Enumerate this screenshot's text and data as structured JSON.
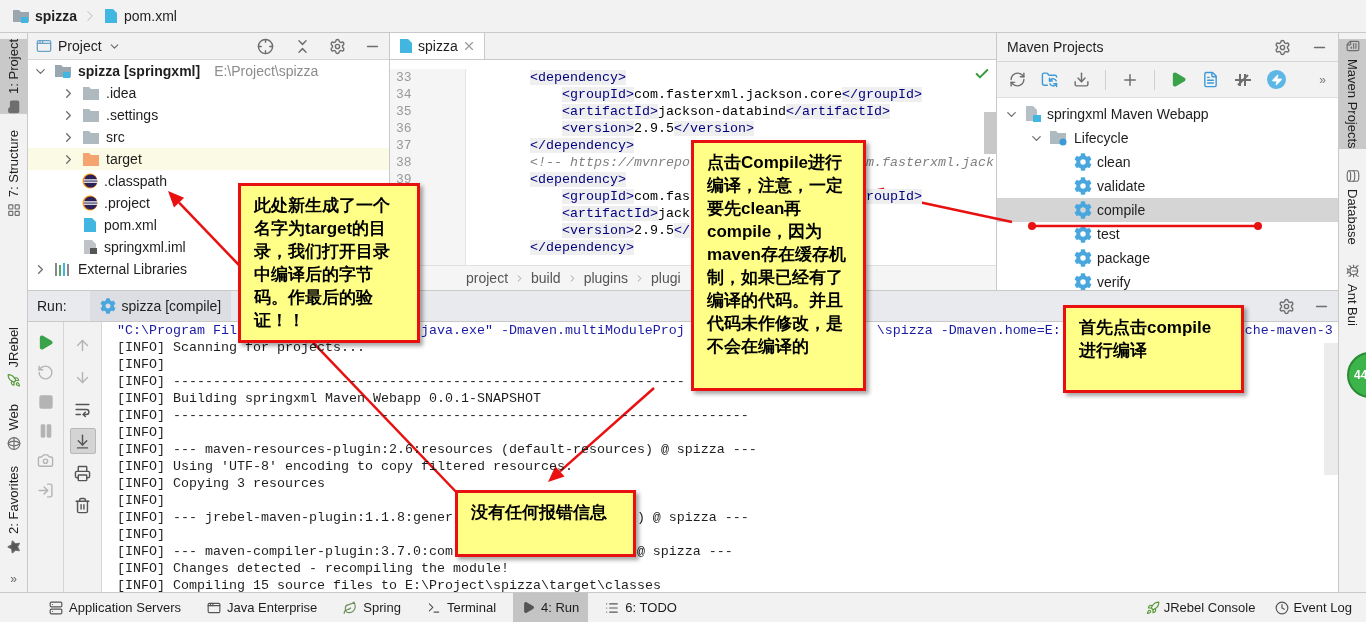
{
  "breadcrumb": [
    {
      "label": "spizza",
      "kind": "module"
    },
    {
      "label": "pom.xml",
      "kind": "maven"
    }
  ],
  "left_stripe": {
    "top": [
      {
        "label": "1: Project",
        "kind": "folder",
        "selected": true
      },
      {
        "label": "7: Structure",
        "kind": "structure",
        "selected": false
      }
    ],
    "bottom": [
      {
        "label": "JRebel",
        "kind": "jrebel"
      },
      {
        "label": "Web",
        "kind": "globe"
      },
      {
        "label": "2: Favorites",
        "kind": "star"
      }
    ],
    "more": "»"
  },
  "project_panel": {
    "title": "Project",
    "tree": [
      {
        "label": "spizza [springxml]",
        "path": "E:\\Project\\spizza",
        "kind": "module",
        "expanded": true,
        "children": [
          {
            "label": ".idea",
            "kind": "folder",
            "expanded": false,
            "highlighted": false
          },
          {
            "label": ".settings",
            "kind": "folder",
            "expanded": false,
            "highlighted": false
          },
          {
            "label": "src",
            "kind": "folder",
            "expanded": false,
            "highlighted": false
          },
          {
            "label": "target",
            "kind": "excluded",
            "expanded": false,
            "highlighted": true
          },
          {
            "label": ".classpath",
            "kind": "eclipse",
            "highlighted": false
          },
          {
            "label": ".project",
            "kind": "eclipse",
            "highlighted": false
          },
          {
            "label": "pom.xml",
            "kind": "maven",
            "highlighted": false
          },
          {
            "label": "springxml.iml",
            "kind": "iml",
            "highlighted": false
          }
        ]
      },
      {
        "label": "External Libraries",
        "kind": "library",
        "expanded": false
      }
    ]
  },
  "editor": {
    "tab": {
      "label": "spizza",
      "selected": true
    },
    "lines": [
      {
        "number": "33",
        "tokens": [
          {
            "kind": "tag",
            "text": "        <dependency>"
          }
        ]
      },
      {
        "number": "34",
        "tokens": [
          {
            "kind": "tag",
            "text": "            <groupId>"
          },
          {
            "kind": "text",
            "text": "com.fasterxml.jackson.core"
          },
          {
            "kind": "tag",
            "text": "</groupId>"
          }
        ]
      },
      {
        "number": "35",
        "tokens": [
          {
            "kind": "tag",
            "text": "            <artifactId>"
          },
          {
            "kind": "text",
            "text": "jackson-databind"
          },
          {
            "kind": "tag",
            "text": "</artifactId>"
          }
        ]
      },
      {
        "number": "36",
        "tokens": [
          {
            "kind": "tag",
            "text": "            <version>"
          },
          {
            "kind": "text",
            "text": "2.9.5"
          },
          {
            "kind": "tag",
            "text": "</version>"
          }
        ]
      },
      {
        "number": "37",
        "tokens": [
          {
            "kind": "tag",
            "text": "        </dependency>"
          }
        ]
      },
      {
        "number": "38",
        "tokens": [
          {
            "kind": "comment",
            "text": "        <!-- https://mvnrepo"
          }
        ],
        "tail": [
          {
            "kind": "comment",
            "text": "m.fasterxml.jack"
          }
        ]
      },
      {
        "number": "39",
        "tokens": [
          {
            "kind": "tag",
            "text": "        <dependency>"
          }
        ]
      },
      {
        "tokens": [
          {
            "kind": "tag",
            "text": "            <groupId>"
          },
          {
            "kind": "text",
            "text": "com.fas"
          }
        ],
        "tail": [
          {
            "kind": "tag",
            "text": "roupId>"
          }
        ]
      },
      {
        "tokens": [
          {
            "kind": "tag",
            "text": "            <artifactId>"
          },
          {
            "kind": "text",
            "text": "jack"
          }
        ]
      },
      {
        "tokens": [
          {
            "kind": "tag",
            "text": "            <version>"
          },
          {
            "kind": "text",
            "text": "2.9.5"
          },
          {
            "kind": "tag",
            "text": "</"
          }
        ]
      },
      {
        "tokens": [
          {
            "kind": "tag",
            "text": "        </dependency>"
          }
        ]
      }
    ],
    "path": [
      "project",
      "build",
      "plugins",
      "plugi"
    ]
  },
  "maven_panel": {
    "title": "Maven Projects",
    "more": "»",
    "tree": [
      {
        "label": "springxml Maven Webapp",
        "kind": "project",
        "expanded": true,
        "children": [
          {
            "label": "Lifecycle",
            "kind": "lifecycle",
            "expanded": true,
            "children": [
              {
                "label": "clean",
                "kind": "goal",
                "selected": false
              },
              {
                "label": "validate",
                "kind": "goal",
                "selected": false
              },
              {
                "label": "compile",
                "kind": "goal",
                "selected": true
              },
              {
                "label": "test",
                "kind": "goal",
                "selected": false
              },
              {
                "label": "package",
                "kind": "goal",
                "selected": false
              },
              {
                "label": "verify",
                "kind": "goal",
                "selected": false
              }
            ]
          }
        ]
      }
    ]
  },
  "right_stripe": [
    {
      "label": "Maven Projects",
      "kind": "maven",
      "selected": true
    },
    {
      "label": "Database",
      "kind": "database",
      "selected": false
    },
    {
      "label": "Ant Bui",
      "kind": "ant",
      "selected": false
    }
  ],
  "run_panel": {
    "title": "Run:",
    "tab": "spizza [compile]",
    "actions": [
      {
        "kind": "run",
        "disabled": false
      },
      {
        "kind": "rerun",
        "disabled": true
      },
      {
        "kind": "stop",
        "disabled": true
      },
      {
        "kind": "pause",
        "disabled": true
      },
      {
        "kind": "dump",
        "disabled": true
      },
      {
        "kind": "exit",
        "disabled": true
      }
    ],
    "tools": [
      {
        "kind": "up",
        "disabled": true,
        "on": false
      },
      {
        "kind": "down",
        "disabled": true,
        "on": false
      },
      {
        "kind": "wrap",
        "disabled": false,
        "on": false
      },
      {
        "kind": "scroll",
        "disabled": false,
        "on": true
      },
      {
        "kind": "print",
        "disabled": false,
        "on": false
      },
      {
        "kind": "clear",
        "disabled": false,
        "on": false
      }
    ],
    "console": [
      {
        "kind": "command",
        "segments": [
          "\"C:\\Program Fil",
          "java.exe\" -Dmaven.multiModuleProj",
          "\\spizza -Dmaven.home=E:",
          "che-maven-3"
        ]
      },
      {
        "kind": "output",
        "segments": [
          "[INFO] Scanning for projects..."
        ]
      },
      {
        "kind": "output",
        "segments": [
          "[INFO]"
        ]
      },
      {
        "kind": "output",
        "segments": [
          "[INFO] ----------------------------------------------------------------"
        ]
      },
      {
        "kind": "output",
        "segments": [
          "[INFO] Building springxml Maven Webapp 0.0.1-SNAPSHOT"
        ]
      },
      {
        "kind": "output",
        "segments": [
          "[INFO] ------------------------------------------------------------------------"
        ]
      },
      {
        "kind": "output",
        "segments": [
          "[INFO]"
        ]
      },
      {
        "kind": "output",
        "segments": [
          "[INFO] --- maven-resources-plugin:2.6:resources (default-resources) @ spizza ---"
        ]
      },
      {
        "kind": "output",
        "segments": [
          "[INFO] Using 'UTF-8' encoding to copy filtered resources."
        ]
      },
      {
        "kind": "output",
        "segments": [
          "[INFO] Copying 3 resources"
        ]
      },
      {
        "kind": "output",
        "segments": [
          "[INFO]"
        ]
      },
      {
        "kind": "output",
        "segments": [
          "[INFO] --- jrebel-maven-plugin:1.1.8:gener",
          ") @ spizza ---"
        ]
      },
      {
        "kind": "output",
        "segments": [
          "[INFO]"
        ]
      },
      {
        "kind": "output",
        "segments": [
          "[INFO] --- maven-compiler-plugin:3.7.0:com",
          "@ spizza ---"
        ]
      },
      {
        "kind": "output",
        "segments": [
          "[INFO] Changes detected - recompiling the module!"
        ]
      },
      {
        "kind": "output",
        "segments": [
          "[INFO] Compiling 15 source files to E:\\Project\\spizza\\target\\classes"
        ]
      }
    ]
  },
  "status_bar": {
    "left": [
      {
        "label": "Application Servers",
        "kind": "server",
        "selected": false
      },
      {
        "label": "Java Enterprise",
        "kind": "ee",
        "selected": false
      },
      {
        "label": "Spring",
        "kind": "leaf",
        "selected": false
      },
      {
        "label": "Terminal",
        "kind": "terminal",
        "selected": false
      },
      {
        "label": "4: Run",
        "kind": "run",
        "selected": true
      },
      {
        "label": "6: TODO",
        "kind": "todo",
        "selected": false
      }
    ],
    "right": [
      {
        "label": "JRebel Console",
        "kind": "jrebel"
      },
      {
        "label": "Event Log",
        "kind": "log"
      }
    ]
  },
  "badge": "44",
  "callouts": [
    {
      "text": "此处新生成了一个名字为target的目录，我们打开目录中编译后的字节码。作最后的验证！！"
    },
    {
      "text": "点击Compile进行编译，注意，一定要先clean再compile，因为maven存在缓存机制，如果已经有了编译的代码。并且代码未作修改，是不会在编译的"
    },
    {
      "text": "首先点击compile 进行编译"
    },
    {
      "text": "没有任何报错信息"
    }
  ]
}
